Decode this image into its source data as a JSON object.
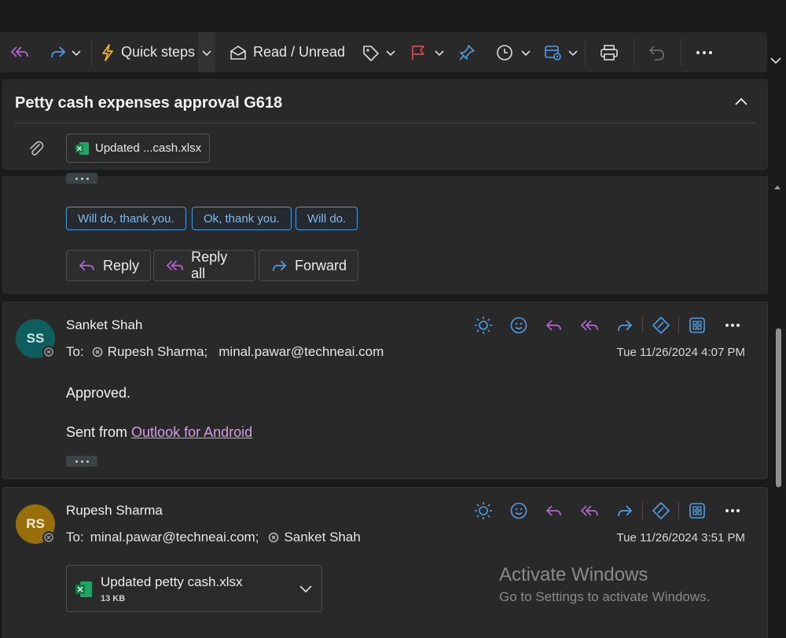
{
  "toolbar": {
    "quick_steps": "Quick steps",
    "read_unread": "Read / Unread"
  },
  "thread": {
    "subject": "Petty cash expenses approval G618",
    "attachment_chip": "Updated ...cash.xlsx"
  },
  "message1": {
    "suggested_replies": [
      "Will do, thank you.",
      "Ok, thank you.",
      "Will do."
    ],
    "reply_label": "Reply",
    "reply_all_label": "Reply all",
    "forward_label": "Forward"
  },
  "message2": {
    "avatar_initials": "SS",
    "avatar_color": "#0f5e5e",
    "sender": "Sanket Shah",
    "to_prefix": "To:",
    "to_1": "Rupesh Sharma;",
    "to_2": "minal.pawar@techneai.com",
    "date": "Tue 11/26/2024 4:07 PM",
    "body": "Approved.",
    "sent_from": "Sent from",
    "sent_from_link": "Outlook for Android"
  },
  "message3": {
    "avatar_initials": "RS",
    "avatar_color": "#986f0b",
    "sender": "Rupesh Sharma",
    "to_prefix": "To:",
    "to_1": "minal.pawar@techneai.com;",
    "to_2": "Sanket Shah",
    "date": "Tue 11/26/2024 3:51 PM",
    "file_name": "Updated petty cash.xlsx",
    "file_size": "13 KB"
  },
  "watermark": {
    "line1": "Activate Windows",
    "line2": "Go to Settings to activate Windows."
  },
  "colors": {
    "accent_blue": "#4f9de3",
    "purple": "#b266cf",
    "flag_red": "#e0444a",
    "quick_steps_yellow": "#f5b91a",
    "excel_green": "#1d7a44"
  }
}
